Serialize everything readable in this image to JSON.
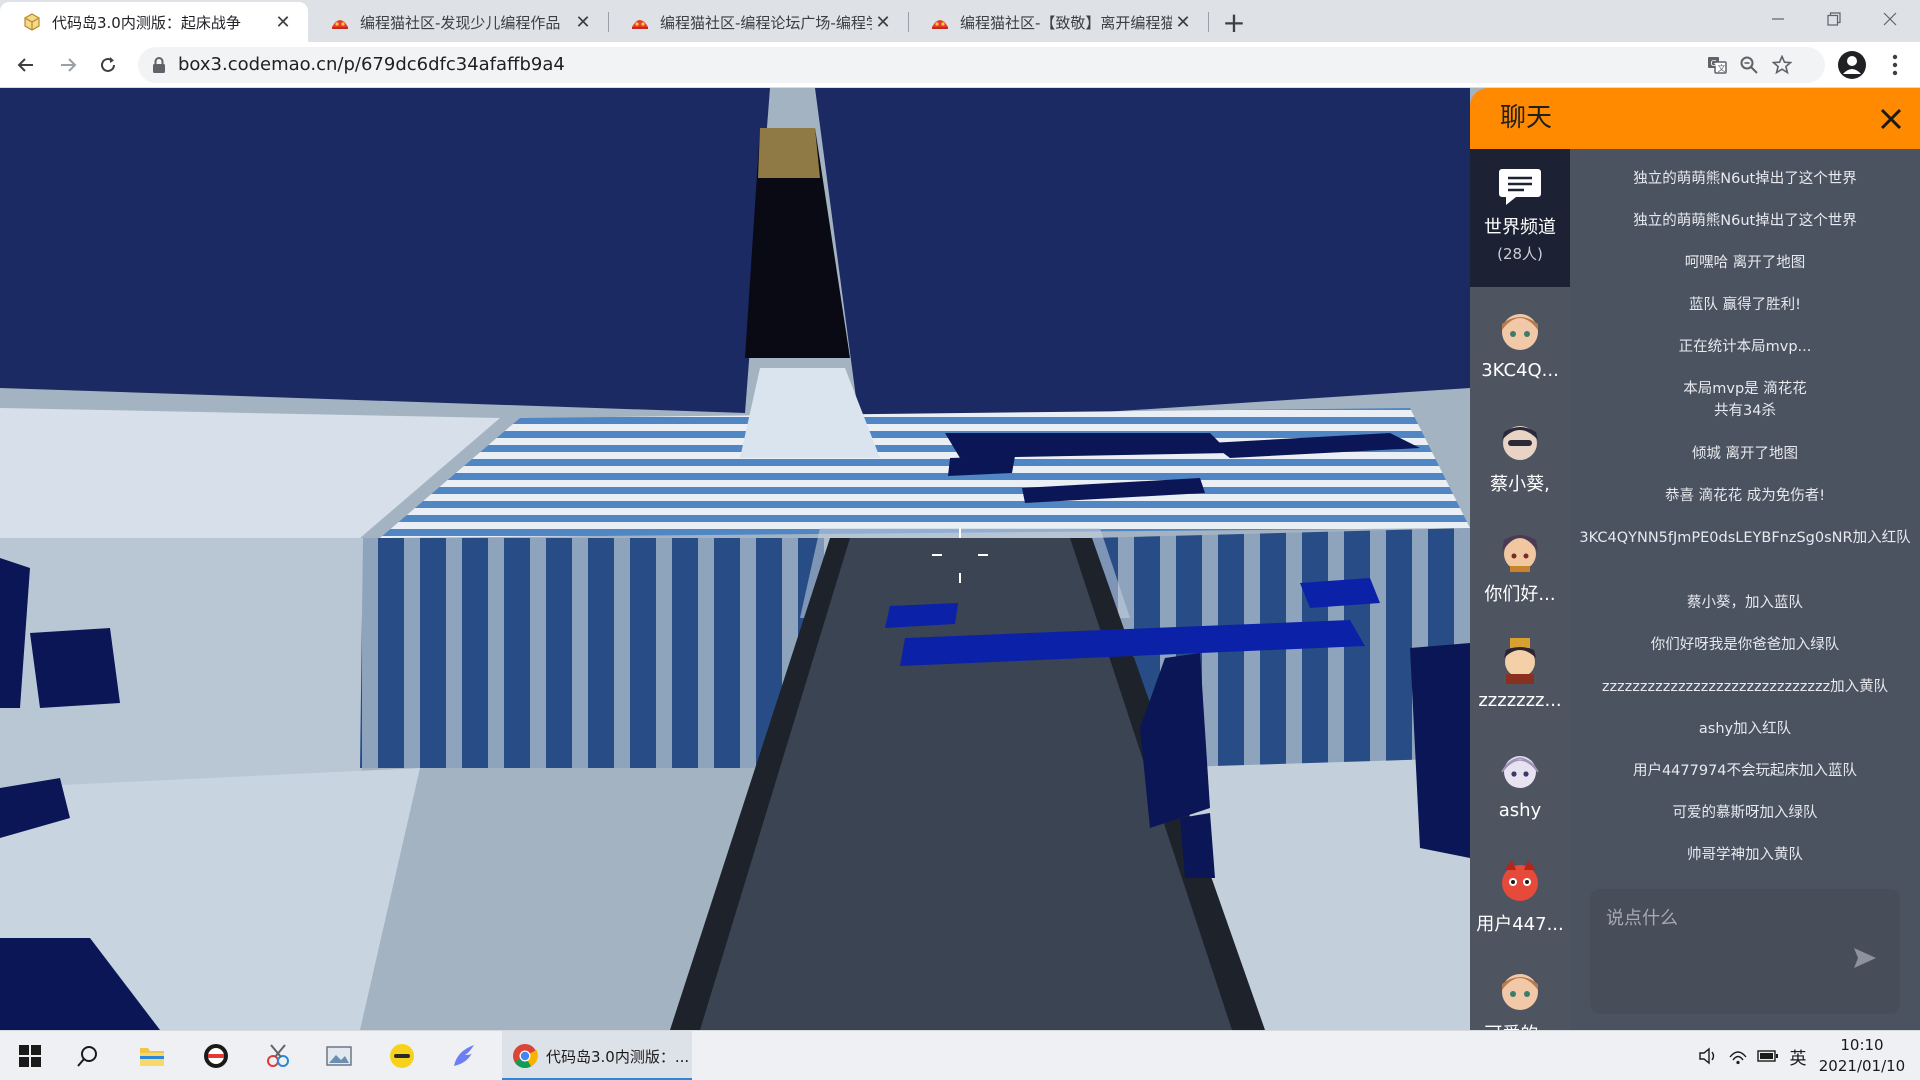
{
  "browser": {
    "tabs": [
      {
        "title": "代码岛3.0内测版：起床战争",
        "active": true,
        "icon": "cube-icon"
      },
      {
        "title": "编程猫社区-发现少儿编程作品",
        "active": false,
        "icon": "codemao-icon"
      },
      {
        "title": "编程猫社区-编程论坛广场-编程学",
        "active": false,
        "icon": "codemao-icon"
      },
      {
        "title": "编程猫社区-【致敬】离开编程猫",
        "active": false,
        "icon": "codemao-icon"
      }
    ],
    "close_glyph": "✕",
    "new_tab_glyph": "+",
    "url": "box3.codemao.cn/p/679dc6dfc34afaffb9a4"
  },
  "chat": {
    "title": "聊天",
    "world_channel": {
      "name": "世界频道",
      "count": "(28人)"
    },
    "players": [
      {
        "name": "3KC4Q...",
        "avatar_color": "#f2c9a8",
        "hair": "#b77a4a"
      },
      {
        "name": "蔡小葵,",
        "avatar_color": "#e9d3c4",
        "hair": "#2a2a3a"
      },
      {
        "name": "你们好...",
        "avatar_color": "#f0c7a0",
        "hair": "#4a3a55"
      },
      {
        "name": "zzzzzzz...",
        "avatar_color": "#f3d0a7",
        "hair": "#2e2430"
      },
      {
        "name": "ashy",
        "avatar_color": "#e8e2f0",
        "hair": "#ffffff"
      },
      {
        "name": "用户447...",
        "avatar_color": "#e64a3a",
        "hair": "#b3261e"
      },
      {
        "name": "可爱的...",
        "avatar_color": "#f2c9a8",
        "hair": "#b77a4a"
      }
    ],
    "messages": [
      "独立的萌萌熊N6ut掉出了这个世界",
      "独立的萌萌熊N6ut掉出了这个世界",
      "呵嘿哈 离开了地图",
      "蓝队 赢得了胜利!",
      "正在统计本局mvp...",
      "本局mvp是 滴花花\n共有34杀",
      "倾城 离开了地图",
      "恭喜 滴花花 成为免伤者!",
      "3KC4QYNN5fJmPE0dsLEYBFnzSg0sNR加入红队",
      "蔡小葵，加入蓝队",
      "你们好呀我是你爸爸加入绿队",
      "zzzzzzzzzzzzzzzzzzzzzzzzzzzzzz加入黄队",
      "ashy加入红队",
      "用户4477974不会玩起床加入蓝队",
      "可爱的慕斯呀加入绿队",
      "帅哥学神加入黄队"
    ],
    "input_placeholder": "说点什么"
  },
  "taskbar": {
    "active_app_label": "代码岛3.0内测版：...",
    "ime": "英",
    "time": "10:10",
    "date": "2021/01/10"
  },
  "colors": {
    "chat_header": "#ff8a00",
    "scene_dark_blue": "#1b2a63",
    "scene_stripe_blue": "#3e6da8"
  }
}
